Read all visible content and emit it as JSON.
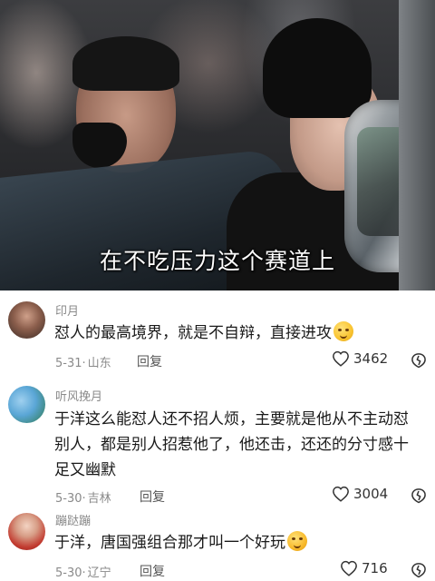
{
  "video": {
    "subtitle": "在不吃压力这个赛道上"
  },
  "comments": [
    {
      "username": "印月",
      "text": "怼人的最高境界，就是不自辩，直接进攻",
      "emoji": "smirk-emoji",
      "date": "5-31",
      "location": "山东",
      "reply_label": "回复",
      "likes": "3462"
    },
    {
      "username": "听风挽月",
      "text_lines": [
        "于洋这么能怼人还不招人烦，主要就是他从不主动怼",
        "别人，都是别人招惹他了，他还击，还还的分寸感十",
        "足又幽默"
      ],
      "date": "5-30",
      "location": "吉林",
      "reply_label": "回复",
      "likes": "3004"
    },
    {
      "username": "蹦跶蹦",
      "text": "于洋，唐国强组合那才叫一个好玩",
      "emoji": "laughing-tears-emoji",
      "date": "5-30",
      "location": "辽宁",
      "reply_label": "回复",
      "likes": "716"
    }
  ],
  "colors": {
    "meta_gray": "#8a8a8a",
    "text": "#1a1a1a"
  }
}
